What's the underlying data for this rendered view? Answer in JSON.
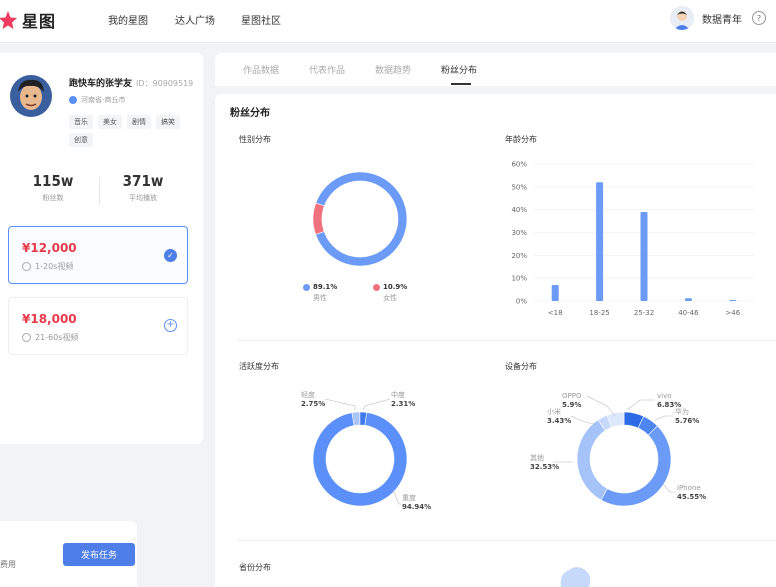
{
  "topnav": {
    "logo_text": "星图",
    "items": [
      "我的星图",
      "达人广场",
      "星图社区"
    ],
    "username": "数据青年",
    "help_glyph": "?"
  },
  "profile": {
    "name": "跑快车的张学友",
    "id": "ID：90909519",
    "location": "河南省-商丘市",
    "tags": [
      "音乐",
      "美女",
      "剧情",
      "搞笑",
      "创意"
    ],
    "stats": [
      {
        "value": "115w",
        "label": "粉丝数"
      },
      {
        "value": "371w",
        "label": "平均播放"
      }
    ]
  },
  "pricing": [
    {
      "price": "¥12,000",
      "duration": "1-20s视频",
      "selected": true
    },
    {
      "price": "¥18,000",
      "duration": "21-60s视频",
      "selected": false
    }
  ],
  "bottom": {
    "fee_text": "费用",
    "publish_label": "发布任务"
  },
  "tabs": [
    "作品数据",
    "代表作品",
    "数据趋势",
    "粉丝分布"
  ],
  "main": {
    "section_title": "粉丝分布",
    "gender_title": "性别分布",
    "age_title": "年龄分布",
    "activity_title": "活跃度分布",
    "device_title": "设备分布",
    "province_title": "省份分布"
  },
  "colors": {
    "primary": "#5b8ff9",
    "female": "#f0727f",
    "price": "#e6394a"
  },
  "chart_data": [
    {
      "type": "pie",
      "name": "gender",
      "categories": [
        "男性",
        "女性"
      ],
      "values": [
        89.1,
        10.9
      ],
      "labels": [
        "89.1%",
        "10.9%"
      ],
      "colors": [
        "#6b9bf6",
        "#f0727f"
      ]
    },
    {
      "type": "bar",
      "name": "age",
      "categories": [
        "<18",
        "18-25",
        "25-32",
        "40-46",
        ">46"
      ],
      "values": [
        7,
        52,
        39,
        1.2,
        0.5
      ],
      "yticks": [
        "0%",
        "10%",
        "20%",
        "30%",
        "40%",
        "50%",
        "60%"
      ],
      "ylim": [
        0,
        60
      ],
      "grid": true
    },
    {
      "type": "pie",
      "name": "activity",
      "categories": [
        "轻度",
        "中度",
        "重度"
      ],
      "values": [
        2.75,
        2.31,
        94.94
      ],
      "labels": [
        "2.75%",
        "2.31%",
        "94.94%"
      ],
      "colors": [
        "#a9c4f8",
        "#3f78ec",
        "#5b8ff9"
      ]
    },
    {
      "type": "pie",
      "name": "device",
      "categories": [
        "vivo",
        "华为",
        "iPhone",
        "其他",
        "小米",
        "OPPO"
      ],
      "values": [
        6.83,
        5.76,
        45.55,
        32.53,
        3.43,
        5.9
      ],
      "labels": [
        "6.83%",
        "5.76%",
        "45.55%",
        "32.53%",
        "3.43%",
        "5.9%"
      ],
      "colors": [
        "#2d6ae6",
        "#4d86f0",
        "#6b9bf6",
        "#a6c3f9",
        "#c7d9fb",
        "#dbe7fc"
      ]
    }
  ]
}
